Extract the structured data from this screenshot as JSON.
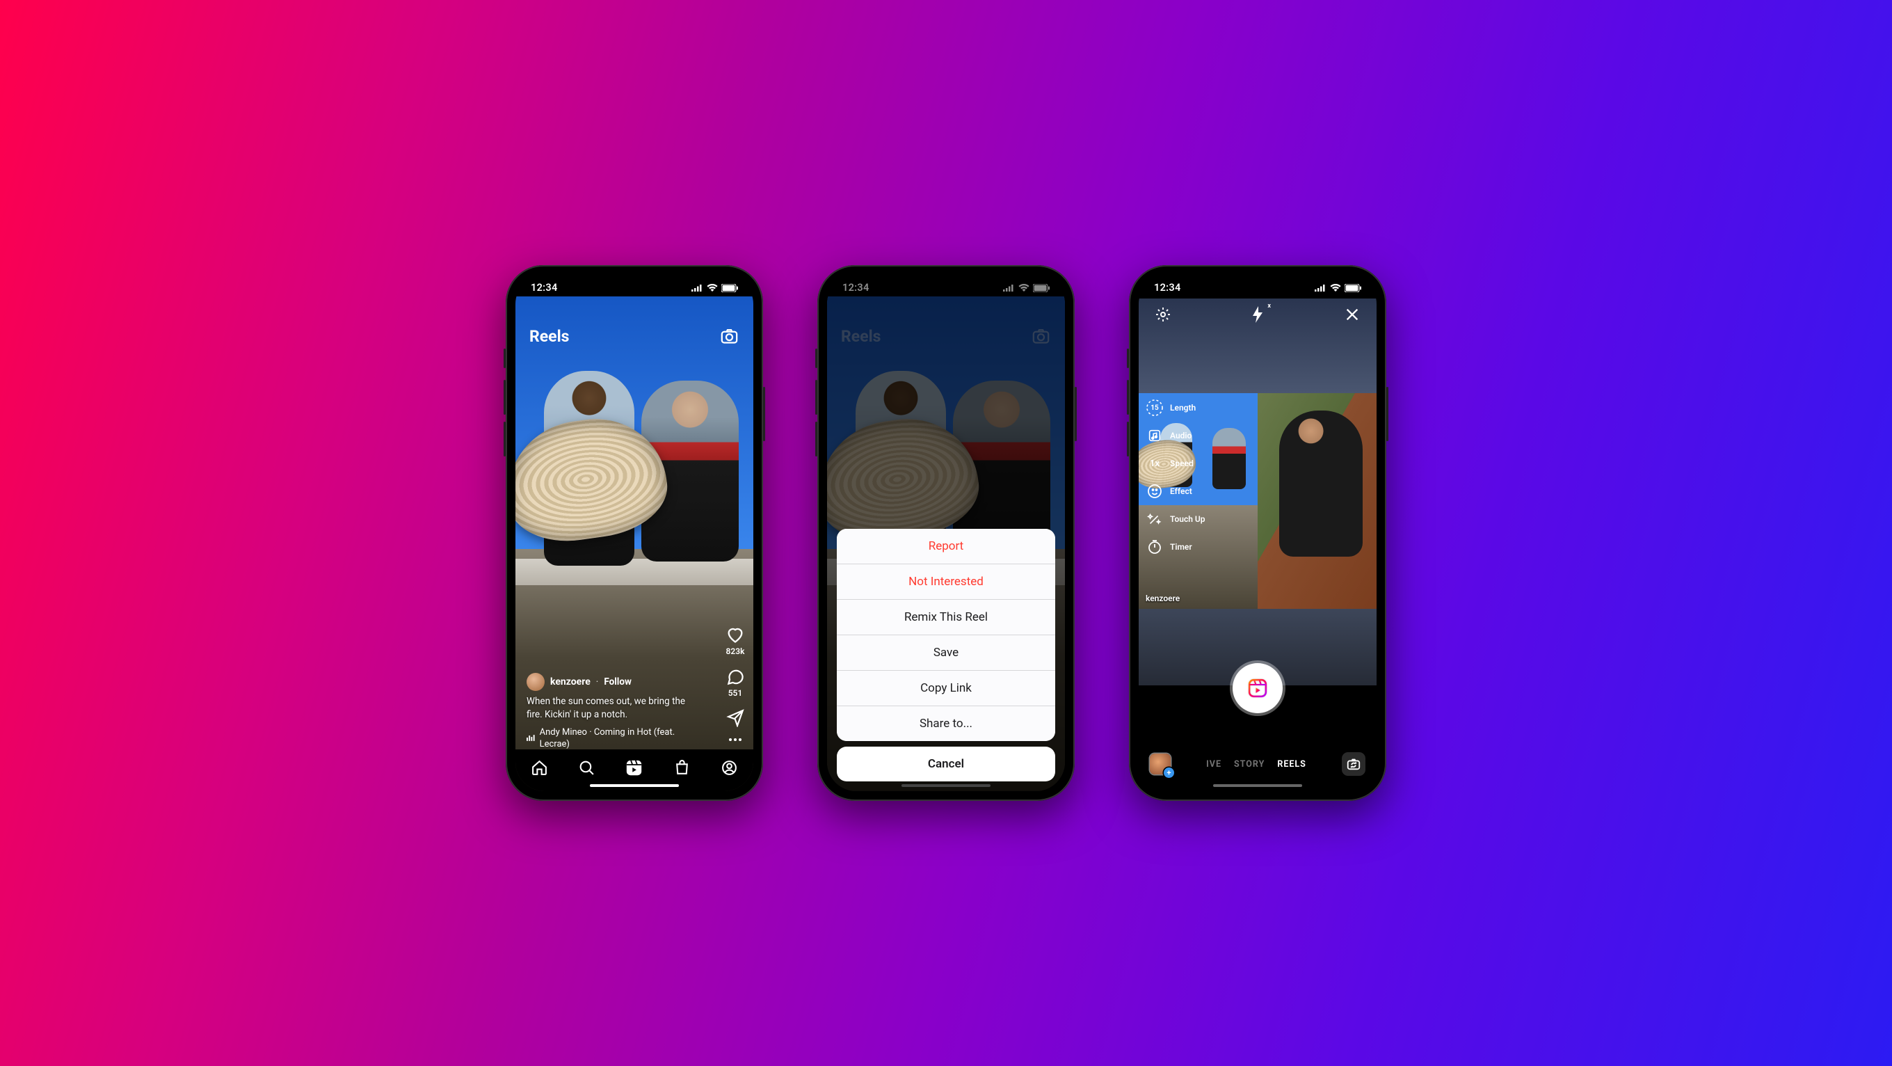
{
  "status": {
    "time": "12:34"
  },
  "screen1": {
    "title": "Reels",
    "likes": "823k",
    "comments": "551",
    "author": "kenzoere",
    "follow": "Follow",
    "caption": "When the sun comes out, we bring the fire. Kickin' it up a notch.",
    "music": "Andy Mineo · Coming in Hot (feat. Lecrae)"
  },
  "screen2": {
    "title": "Reels",
    "sheet": {
      "report": "Report",
      "not_interested": "Not Interested",
      "remix": "Remix This Reel",
      "save": "Save",
      "copy_link": "Copy Link",
      "share_to": "Share to...",
      "cancel": "Cancel"
    }
  },
  "screen3": {
    "flash_badge": "x",
    "tools": {
      "length_value": "15",
      "length": "Length",
      "audio": "Audio",
      "speed_value": "1x",
      "speed": "Speed",
      "effect": "Effect",
      "touchup": "Touch Up",
      "timer": "Timer"
    },
    "source_username": "kenzoere",
    "modes": {
      "live": "IVE",
      "story": "STORY",
      "reels": "REELS"
    }
  }
}
